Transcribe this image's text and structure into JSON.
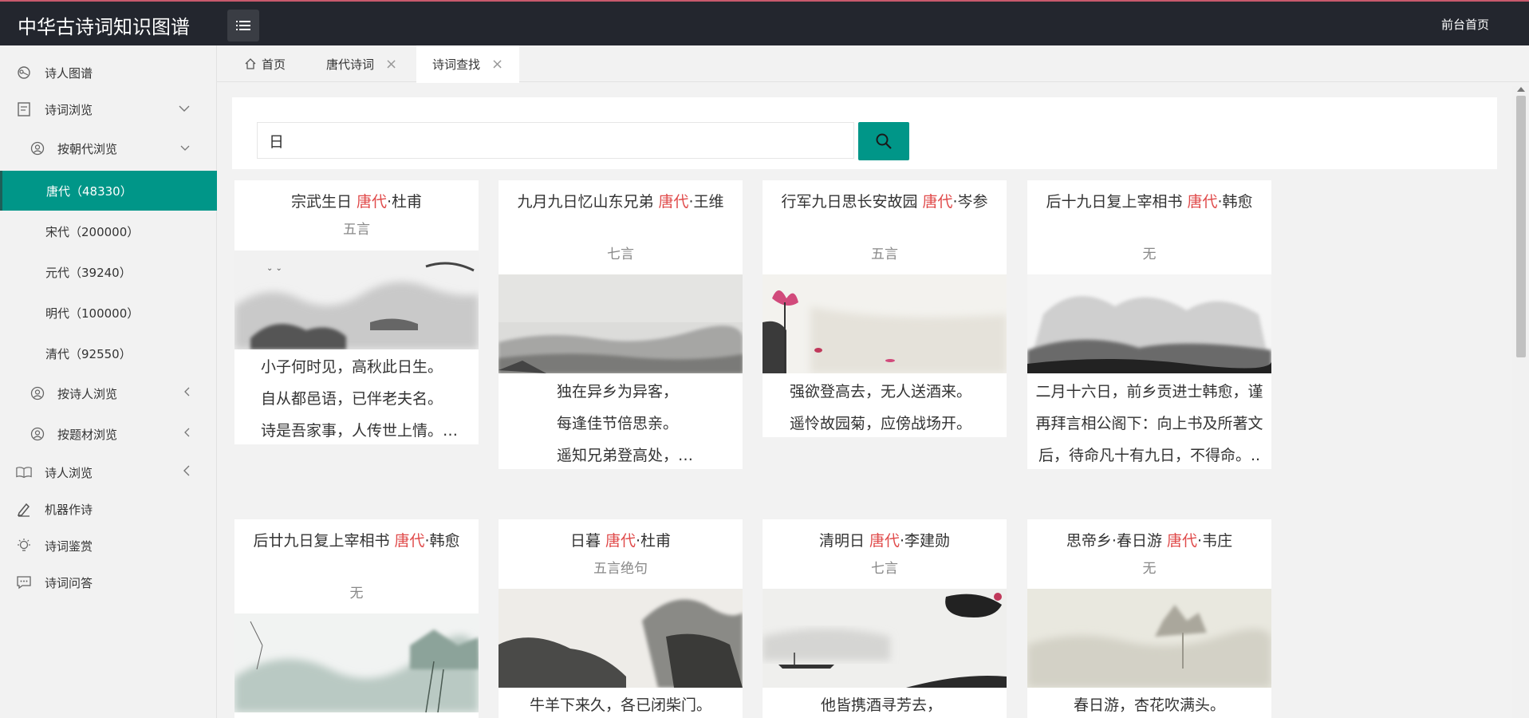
{
  "header": {
    "title": "中华古诗词知识图谱",
    "front_link": "前台首页"
  },
  "sidebar": {
    "items": [
      {
        "label": "诗人图谱"
      },
      {
        "label": "诗词浏览"
      },
      {
        "label": "按朝代浏览"
      },
      {
        "label": "唐代（48330）"
      },
      {
        "label": "宋代（200000）"
      },
      {
        "label": "元代（39240）"
      },
      {
        "label": "明代（100000）"
      },
      {
        "label": "清代（92550）"
      },
      {
        "label": "按诗人浏览"
      },
      {
        "label": "按题材浏览"
      },
      {
        "label": "诗人浏览"
      },
      {
        "label": "机器作诗"
      },
      {
        "label": "诗词鉴赏"
      },
      {
        "label": "诗词问答"
      }
    ]
  },
  "tabs": [
    {
      "label": "首页"
    },
    {
      "label": "唐代诗词"
    },
    {
      "label": "诗词查找"
    }
  ],
  "search": {
    "value": "日"
  },
  "cards": [
    {
      "title": "宗武生日",
      "dynasty": "唐代",
      "author": "·杜甫",
      "form": "五言",
      "lines": [
        "小子何时见，高秋此日生。",
        "自从都邑语，已伴老夫名。",
        "诗是吾家事，人传世上情。…"
      ]
    },
    {
      "title": "九月九日忆山东兄弟",
      "dynasty": "唐代",
      "author": "·王维",
      "form": "七言",
      "lines": [
        "独在异乡为异客，",
        "每逢佳节倍思亲。",
        "遥知兄弟登高处，…"
      ]
    },
    {
      "title": "行军九日思长安故园",
      "dynasty": "唐代",
      "author": "·岑参",
      "form": "五言",
      "lines": [
        "强欲登高去，无人送酒来。",
        "遥怜故园菊，应傍战场开。"
      ]
    },
    {
      "title": "后十九日复上宰相书",
      "dynasty": "唐代",
      "author": "·韩愈",
      "form": "无",
      "lines": [
        "二月十六日，前乡贡进士韩愈，谨",
        "再拜言相公阁下：向上书及所著文",
        "后，待命凡十有九日，不得命。.."
      ]
    },
    {
      "title": "后廿九日复上宰相书",
      "dynasty": "唐代",
      "author": "·韩愈",
      "form": "无",
      "lines": []
    },
    {
      "title": "日暮",
      "dynasty": "唐代",
      "author": "·杜甫",
      "form": "五言绝句",
      "lines": [
        "牛羊下来久，各已闭柴门。"
      ]
    },
    {
      "title": "清明日",
      "dynasty": "唐代",
      "author": "·李建勋",
      "form": "七言",
      "lines": [
        "他皆携酒寻芳去，"
      ]
    },
    {
      "title": "思帝乡·春日游",
      "dynasty": "唐代",
      "author": "·韦庄",
      "form": "无",
      "lines": [
        "春日游，杏花吹满头。"
      ]
    }
  ],
  "colors": {
    "accent": "#009688",
    "header_bg": "#23262e",
    "dynasty_text": "#e04b4b"
  }
}
